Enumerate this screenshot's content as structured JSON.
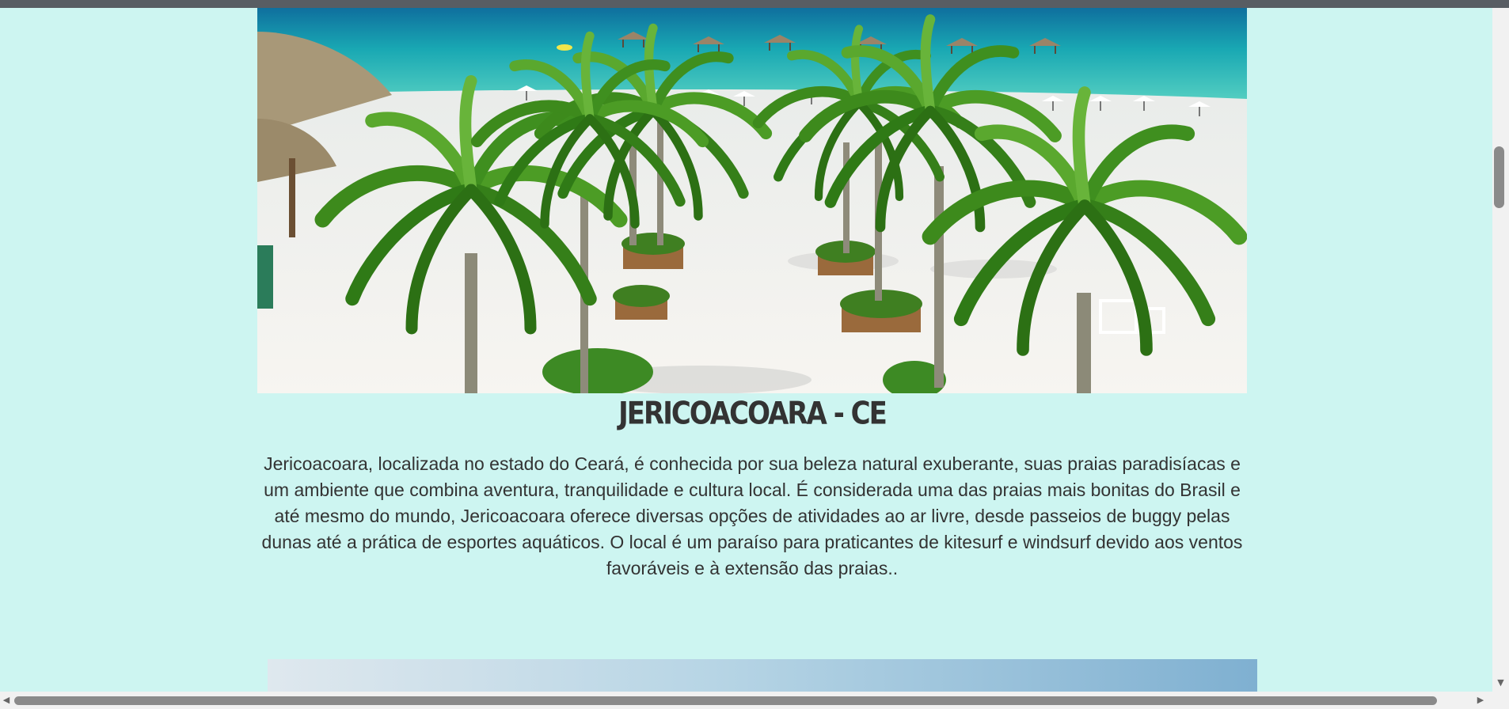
{
  "section": {
    "title": "JERICOACOARA - CE",
    "description": "Jericoacoara, localizada no estado do Ceará, é conhecida por sua beleza natural exuberante, suas praias paradisíacas e um ambiente que combina aventura, tranquilidade e cultura local. É considerada uma das praias mais bonitas do Brasil e até mesmo do mundo, Jericoacoara oferece diversas opções de atividades ao ar livre, desde passeios de buggy pelas dunas até a prática de esportes aquáticos. O local é um paraíso para praticantes de kitesurf e windsurf devido aos ventos favoráveis e à extensão das praias.."
  },
  "colors": {
    "background": "#cdf5f1",
    "text": "#333333",
    "sea": "#1fb4a8",
    "sand": "#f4f2ee",
    "palm": "#3f8f1f"
  },
  "icons": {
    "scroll_up": "caret-up-icon",
    "scroll_down": "caret-down-icon",
    "scroll_left": "caret-left-icon",
    "scroll_right": "caret-right-icon"
  }
}
